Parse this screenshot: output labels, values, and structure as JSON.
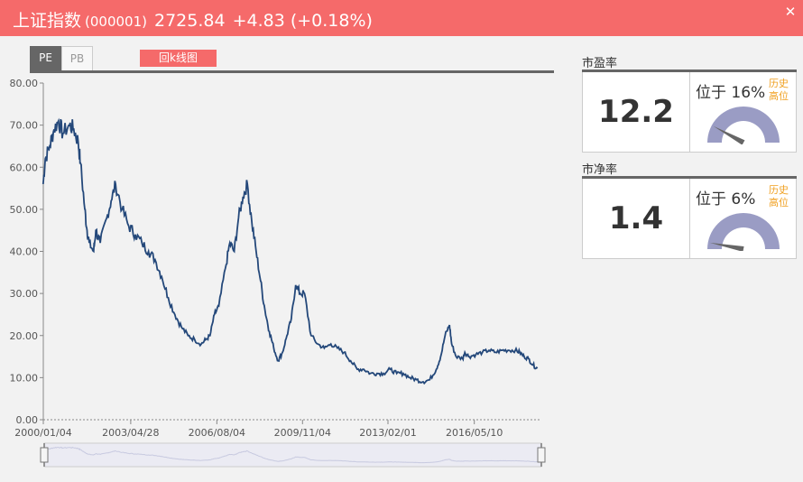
{
  "header": {
    "index_name": "上证指数",
    "index_code": "(000001)",
    "points": "2725.84",
    "change": "+4.83 (+0.18%)",
    "close_icon": "close-icon"
  },
  "tabs": [
    {
      "label": "PE",
      "active": true
    },
    {
      "label": "PB",
      "active": false
    }
  ],
  "back_kline_label": "回k线图",
  "pe_panel": {
    "title": "市盈率",
    "value": "12.2",
    "position_text": "位于 16%",
    "history_label": "历史高位",
    "percentile": 0.16
  },
  "pb_panel": {
    "title": "市净率",
    "value": "1.4",
    "position_text": "位于  6%",
    "history_label": "历史高位",
    "percentile": 0.06
  },
  "colors": {
    "header_bg": "#f56a6a",
    "line": "#24487a",
    "accent_text": "#f0a020",
    "gauge": "#9a9cc4"
  },
  "chart_data": {
    "type": "line",
    "title": "",
    "xlabel": "",
    "ylabel": "",
    "ylim": [
      0,
      80
    ],
    "yticks": [
      "0.00",
      "10.00",
      "20.00",
      "30.00",
      "40.00",
      "50.00",
      "60.00",
      "70.00",
      "80.00"
    ],
    "xticks": [
      "2000/01/04",
      "2003/04/28",
      "2006/08/04",
      "2009/11/04",
      "2013/02/01",
      "2016/05/10"
    ],
    "x_range": [
      "2000/01/04",
      "2018/11"
    ],
    "series": [
      {
        "x": [
          "2000/01",
          "2000/02",
          "2000/04",
          "2000/06",
          "2000/08",
          "2000/10",
          "2001/01",
          "2001/03",
          "2001/05",
          "2001/06",
          "2001/08",
          "2001/09",
          "2001/10",
          "2001/12",
          "2002/01",
          "2002/03",
          "2002/06",
          "2002/08",
          "2002/10",
          "2003/01",
          "2003/04",
          "2003/07",
          "2003/10",
          "2004/01",
          "2004/04",
          "2004/07",
          "2004/10",
          "2005/01",
          "2005/04",
          "2005/07",
          "2005/10",
          "2006/01",
          "2006/03",
          "2006/05",
          "2006/07",
          "2006/09",
          "2006/12",
          "2007/02",
          "2007/04",
          "2007/06",
          "2007/08",
          "2007/10",
          "2007/12",
          "2008/02",
          "2008/04",
          "2008/06",
          "2008/08",
          "2008/10",
          "2008/12",
          "2009/02",
          "2009/04",
          "2009/06",
          "2009/08",
          "2009/10",
          "2009/12",
          "2010/03",
          "2010/06",
          "2010/09",
          "2010/12",
          "2011/03",
          "2011/06",
          "2011/09",
          "2011/12",
          "2012/03",
          "2012/06",
          "2012/09",
          "2012/12",
          "2013/03",
          "2013/06",
          "2013/09",
          "2013/12",
          "2014/03",
          "2014/06",
          "2014/09",
          "2014/12",
          "2015/02",
          "2015/04",
          "2015/06",
          "2015/07",
          "2015/09",
          "2015/12",
          "2016/01",
          "2016/03",
          "2016/06",
          "2016/09",
          "2016/12",
          "2017/03",
          "2017/06",
          "2017/09",
          "2017/12",
          "2018/02",
          "2018/04",
          "2018/06",
          "2018/08",
          "2018/10"
        ],
        "values": [
          56,
          62,
          65,
          69,
          71,
          68,
          70,
          69,
          66,
          61,
          50,
          45,
          42,
          40,
          45,
          42,
          48,
          52,
          56,
          50,
          46,
          44,
          42,
          40,
          38,
          34,
          29,
          25,
          22,
          20,
          19,
          18,
          19,
          20,
          25,
          27,
          36,
          42,
          40,
          48,
          53,
          56,
          47,
          40,
          33,
          26,
          21,
          17,
          14,
          16,
          20,
          24,
          32,
          30,
          30,
          20,
          18,
          17,
          18,
          17,
          16,
          14,
          12,
          12,
          11,
          11,
          11,
          12,
          11,
          11,
          10,
          9.5,
          9,
          9.5,
          12,
          15,
          20,
          22.5,
          18,
          15,
          14.5,
          16,
          15,
          15.5,
          16,
          16.5,
          16,
          16.5,
          16.5,
          16.5,
          16,
          15,
          14.5,
          13,
          12.2
        ]
      }
    ],
    "legend": "none",
    "grid": false
  }
}
